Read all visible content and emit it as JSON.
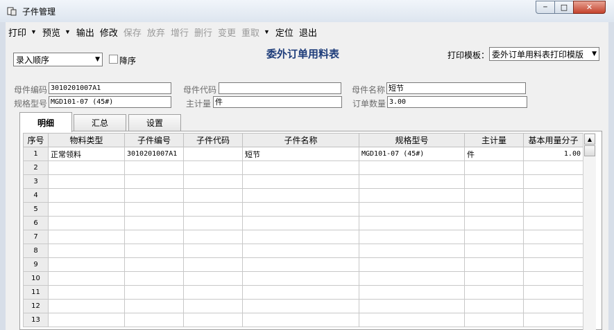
{
  "window": {
    "title": "子件管理",
    "controls": {
      "minimize": "─",
      "maximize": "□",
      "close": "✕"
    }
  },
  "toolbar": {
    "items": [
      {
        "label": "打印",
        "dropdown": true,
        "enabled": true
      },
      {
        "label": "预览",
        "dropdown": true,
        "enabled": true
      },
      {
        "label": "输出",
        "dropdown": false,
        "enabled": true
      },
      {
        "label": "修改",
        "dropdown": false,
        "enabled": true
      },
      {
        "label": "保存",
        "dropdown": false,
        "enabled": false
      },
      {
        "label": "放弃",
        "dropdown": false,
        "enabled": false
      },
      {
        "label": "增行",
        "dropdown": false,
        "enabled": false
      },
      {
        "label": "删行",
        "dropdown": false,
        "enabled": false
      },
      {
        "label": "变更",
        "dropdown": false,
        "enabled": false
      },
      {
        "label": "重取",
        "dropdown": true,
        "enabled": false
      },
      {
        "label": "定位",
        "dropdown": false,
        "enabled": true
      },
      {
        "label": "退出",
        "dropdown": false,
        "enabled": true
      }
    ]
  },
  "sort": {
    "value": "录入顺序",
    "desc_label": "降序",
    "desc_checked": false
  },
  "report_title": "委外订单用料表",
  "template": {
    "label": "打印模板：",
    "value": "委外订单用料表打印模版"
  },
  "form": {
    "parent_code_label": "母件编码",
    "parent_code": "3010201007A1",
    "parent_id_label": "母件代码",
    "parent_id": "",
    "parent_name_label": "母件名称",
    "parent_name": "短节",
    "spec_label": "规格型号",
    "spec": "MGD101-07 (45#)",
    "unit_label": "主计量",
    "unit": "件",
    "qty_label": "订单数量",
    "qty": "3.00"
  },
  "tabs": [
    "明细",
    "汇总",
    "设置"
  ],
  "grid": {
    "columns": [
      "序号",
      "物料类型",
      "子件编号",
      "子件代码",
      "子件名称",
      "规格型号",
      "主计量",
      "基本用量分子"
    ],
    "rows": [
      [
        "1",
        "正常领料",
        "3010201007A1",
        "",
        "短节",
        "MGD101-07 (45#)",
        "件",
        "1.00"
      ],
      [
        "2",
        "",
        "",
        "",
        "",
        "",
        "",
        ""
      ],
      [
        "3",
        "",
        "",
        "",
        "",
        "",
        "",
        ""
      ],
      [
        "4",
        "",
        "",
        "",
        "",
        "",
        "",
        ""
      ],
      [
        "5",
        "",
        "",
        "",
        "",
        "",
        "",
        ""
      ],
      [
        "6",
        "",
        "",
        "",
        "",
        "",
        "",
        ""
      ],
      [
        "7",
        "",
        "",
        "",
        "",
        "",
        "",
        ""
      ],
      [
        "8",
        "",
        "",
        "",
        "",
        "",
        "",
        ""
      ],
      [
        "9",
        "",
        "",
        "",
        "",
        "",
        "",
        ""
      ],
      [
        "10",
        "",
        "",
        "",
        "",
        "",
        "",
        ""
      ],
      [
        "11",
        "",
        "",
        "",
        "",
        "",
        "",
        ""
      ],
      [
        "12",
        "",
        "",
        "",
        "",
        "",
        "",
        ""
      ],
      [
        "13",
        "",
        "",
        "",
        "",
        "",
        "",
        ""
      ]
    ]
  }
}
